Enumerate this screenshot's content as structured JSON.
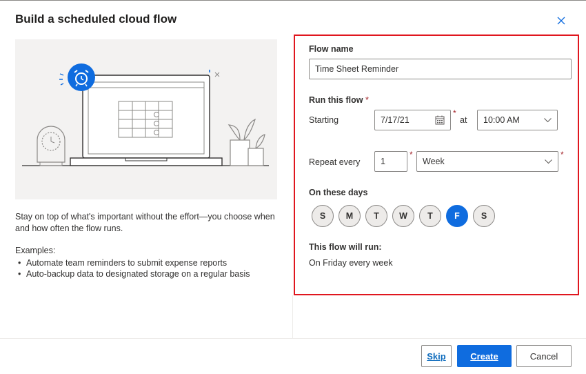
{
  "dialog": {
    "title": "Build a scheduled cloud flow",
    "close_icon": "close-icon"
  },
  "left": {
    "illustration_icon": "alarm-clock-icon",
    "description": "Stay on top of what's important without the effort—you choose when and how often the flow runs.",
    "examples_title": "Examples:",
    "examples": [
      "Automate team reminders to submit expense reports",
      "Auto-backup data to designated storage on a regular basis"
    ]
  },
  "form": {
    "flow_name_label": "Flow name",
    "flow_name_value": "Time Sheet Reminder",
    "run_label": "Run this flow",
    "required_mark": "*",
    "starting_label": "Starting",
    "start_date": "7/17/21",
    "at_label": "at",
    "start_time": "10:00 AM",
    "repeat_label": "Repeat every",
    "repeat_interval": "1",
    "repeat_unit": "Week",
    "days_label": "On these days",
    "days": [
      "S",
      "M",
      "T",
      "W",
      "T",
      "F",
      "S"
    ],
    "selected_day_index": 5,
    "summary_label": "This flow will run:",
    "summary_value": "On Friday every week"
  },
  "footer": {
    "skip_label": "Skip",
    "create_label": "Create",
    "cancel_label": "Cancel"
  },
  "colors": {
    "accent": "#0f6cdf",
    "highlight": "#e0161e",
    "required": "#a4262c"
  }
}
